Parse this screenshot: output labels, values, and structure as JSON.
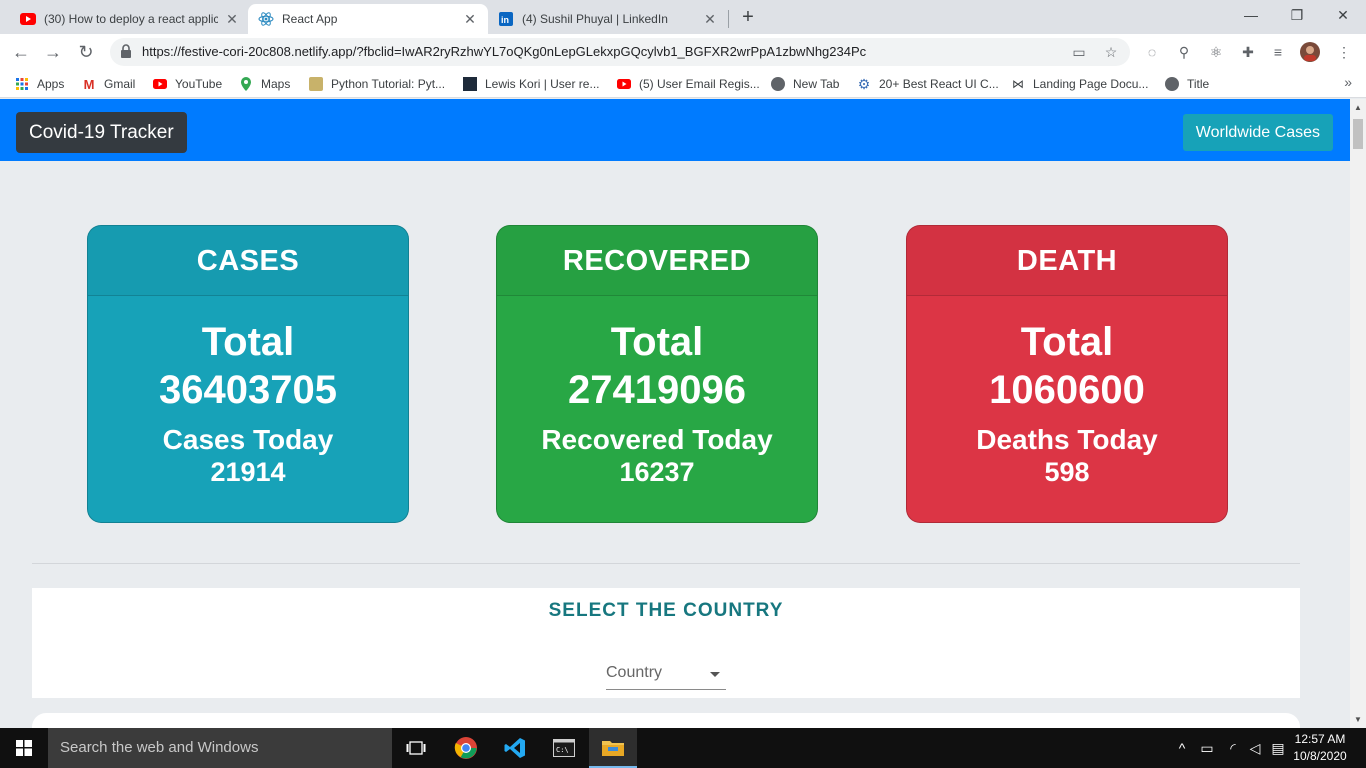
{
  "browser": {
    "tabs": [
      {
        "title": "(30) How to deploy a react applic",
        "favicon": "youtube-icon",
        "active": false
      },
      {
        "title": "React App",
        "favicon": "react-icon",
        "active": true
      },
      {
        "title": "(4) Sushil Phuyal | LinkedIn",
        "favicon": "linkedin-icon",
        "active": false
      }
    ],
    "url": "https://festive-cori-20c808.netlify.app/?fbclid=IwAR2ryRzhwYL7oQKg0nLepGLekxpGQcylvb1_BGFXR2wrPpA1zbwNhg234Pc",
    "bookmarks": [
      {
        "label": "Apps",
        "icon": "apps-grid-icon"
      },
      {
        "label": "Gmail",
        "icon": "gmail-icon"
      },
      {
        "label": "YouTube",
        "icon": "youtube-icon"
      },
      {
        "label": "Maps",
        "icon": "maps-icon"
      },
      {
        "label": "Python Tutorial: Pyt...",
        "icon": "python-icon"
      },
      {
        "label": "Lewis Kori | User re...",
        "icon": "site-icon"
      },
      {
        "label": "(5) User Email Regis...",
        "icon": "youtube-icon"
      },
      {
        "label": "New Tab",
        "icon": "globe-icon"
      },
      {
        "label": "20+ Best React UI C...",
        "icon": "gear-icon"
      },
      {
        "label": "Landing Page Docu...",
        "icon": "bow-icon"
      },
      {
        "label": "Title",
        "icon": "globe-icon"
      }
    ]
  },
  "app": {
    "brand": "Covid-19 Tracker",
    "worldwide_button": "Worldwide Cases",
    "cards": {
      "cases": {
        "header": "CASES",
        "total_label": "Total",
        "total_value": "36403705",
        "today_label": "Cases Today",
        "today_value": "21914",
        "color": "#17a2b8"
      },
      "recovered": {
        "header": "RECOVERED",
        "total_label": "Total",
        "total_value": "27419096",
        "today_label": "Recovered Today",
        "today_value": "16237",
        "color": "#28a745"
      },
      "death": {
        "header": "DEATH",
        "total_label": "Total",
        "total_value": "1060600",
        "today_label": "Deaths Today",
        "today_value": "598",
        "color": "#dc3545"
      }
    },
    "country_section": {
      "heading": "SELECT THE COUNTRY",
      "select_value": "Country"
    }
  },
  "taskbar": {
    "search_placeholder": "Search the web and Windows",
    "time": "12:57 AM",
    "date": "10/8/2020"
  }
}
